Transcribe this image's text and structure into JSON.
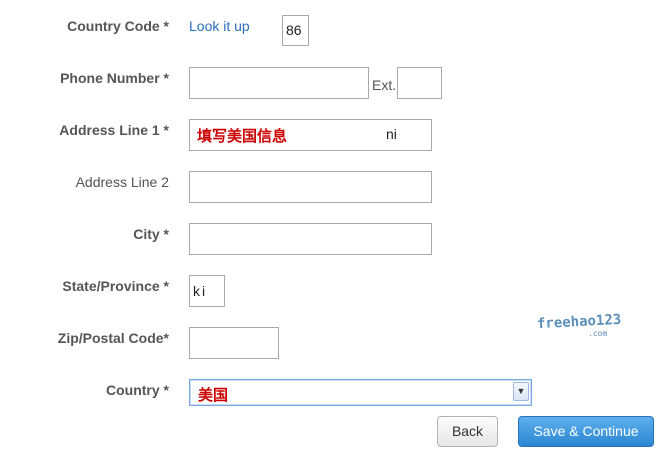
{
  "fields": {
    "country_code": {
      "label": "Country Code *",
      "link": "Look it up",
      "value": "86"
    },
    "phone": {
      "label": "Phone Number *",
      "value": "",
      "ext_label": "Ext.",
      "ext_value": ""
    },
    "address1": {
      "label": "Address Line 1 *",
      "value_prefix": "填写美国信息",
      "value_suffix": "ni"
    },
    "address2": {
      "label": "Address Line 2",
      "value": ""
    },
    "city": {
      "label": "City *",
      "value": ""
    },
    "state": {
      "label": "State/Province *",
      "value": "ki"
    },
    "zip": {
      "label": "Zip/Postal Code*",
      "value": ""
    },
    "country": {
      "label": "Country *",
      "value": "美国"
    }
  },
  "buttons": {
    "back": "Back",
    "save": "Save & Continue"
  },
  "watermark": {
    "text": "freehao123",
    "sub": ".com"
  },
  "colors": {
    "link": "#2a6ebb",
    "annotation": "#cc0000",
    "save_button": "#3a95dd"
  }
}
